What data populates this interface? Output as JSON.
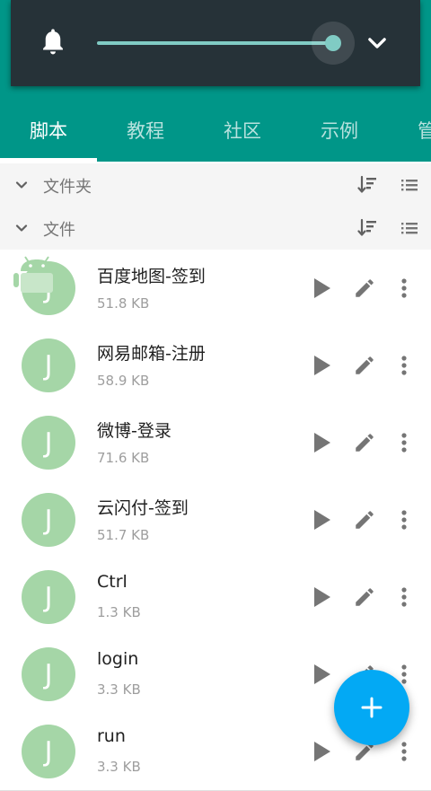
{
  "tabs": [
    {
      "label": "脚本",
      "active": true
    },
    {
      "label": "教程",
      "active": false
    },
    {
      "label": "社区",
      "active": false
    },
    {
      "label": "示例",
      "active": false
    },
    {
      "label": "管",
      "active": false
    }
  ],
  "volume": {
    "level": 0.9,
    "icon": "bell-icon",
    "expand_icon": "chevron-down-icon"
  },
  "sections": [
    {
      "title": "文件夹"
    },
    {
      "title": "文件"
    }
  ],
  "files": [
    {
      "avatar": "J",
      "name": "百度地图-签到",
      "size": "51.8 KB"
    },
    {
      "avatar": "J",
      "name": "网易邮箱-注册",
      "size": "58.9 KB"
    },
    {
      "avatar": "J",
      "name": "微博-登录",
      "size": "71.6 KB"
    },
    {
      "avatar": "J",
      "name": "云闪付-签到",
      "size": "51.7 KB"
    },
    {
      "avatar": "J",
      "name": "Ctrl",
      "size": "1.3 KB"
    },
    {
      "avatar": "J",
      "name": "login",
      "size": "3.3 KB"
    },
    {
      "avatar": "J",
      "name": "run",
      "size": "3.3 KB"
    }
  ],
  "fab": {
    "icon": "plus-icon"
  },
  "colors": {
    "accent": "#009688",
    "fab": "#03a9f4",
    "avatar": "#a5d6a7",
    "volume_panel": "#263238"
  }
}
